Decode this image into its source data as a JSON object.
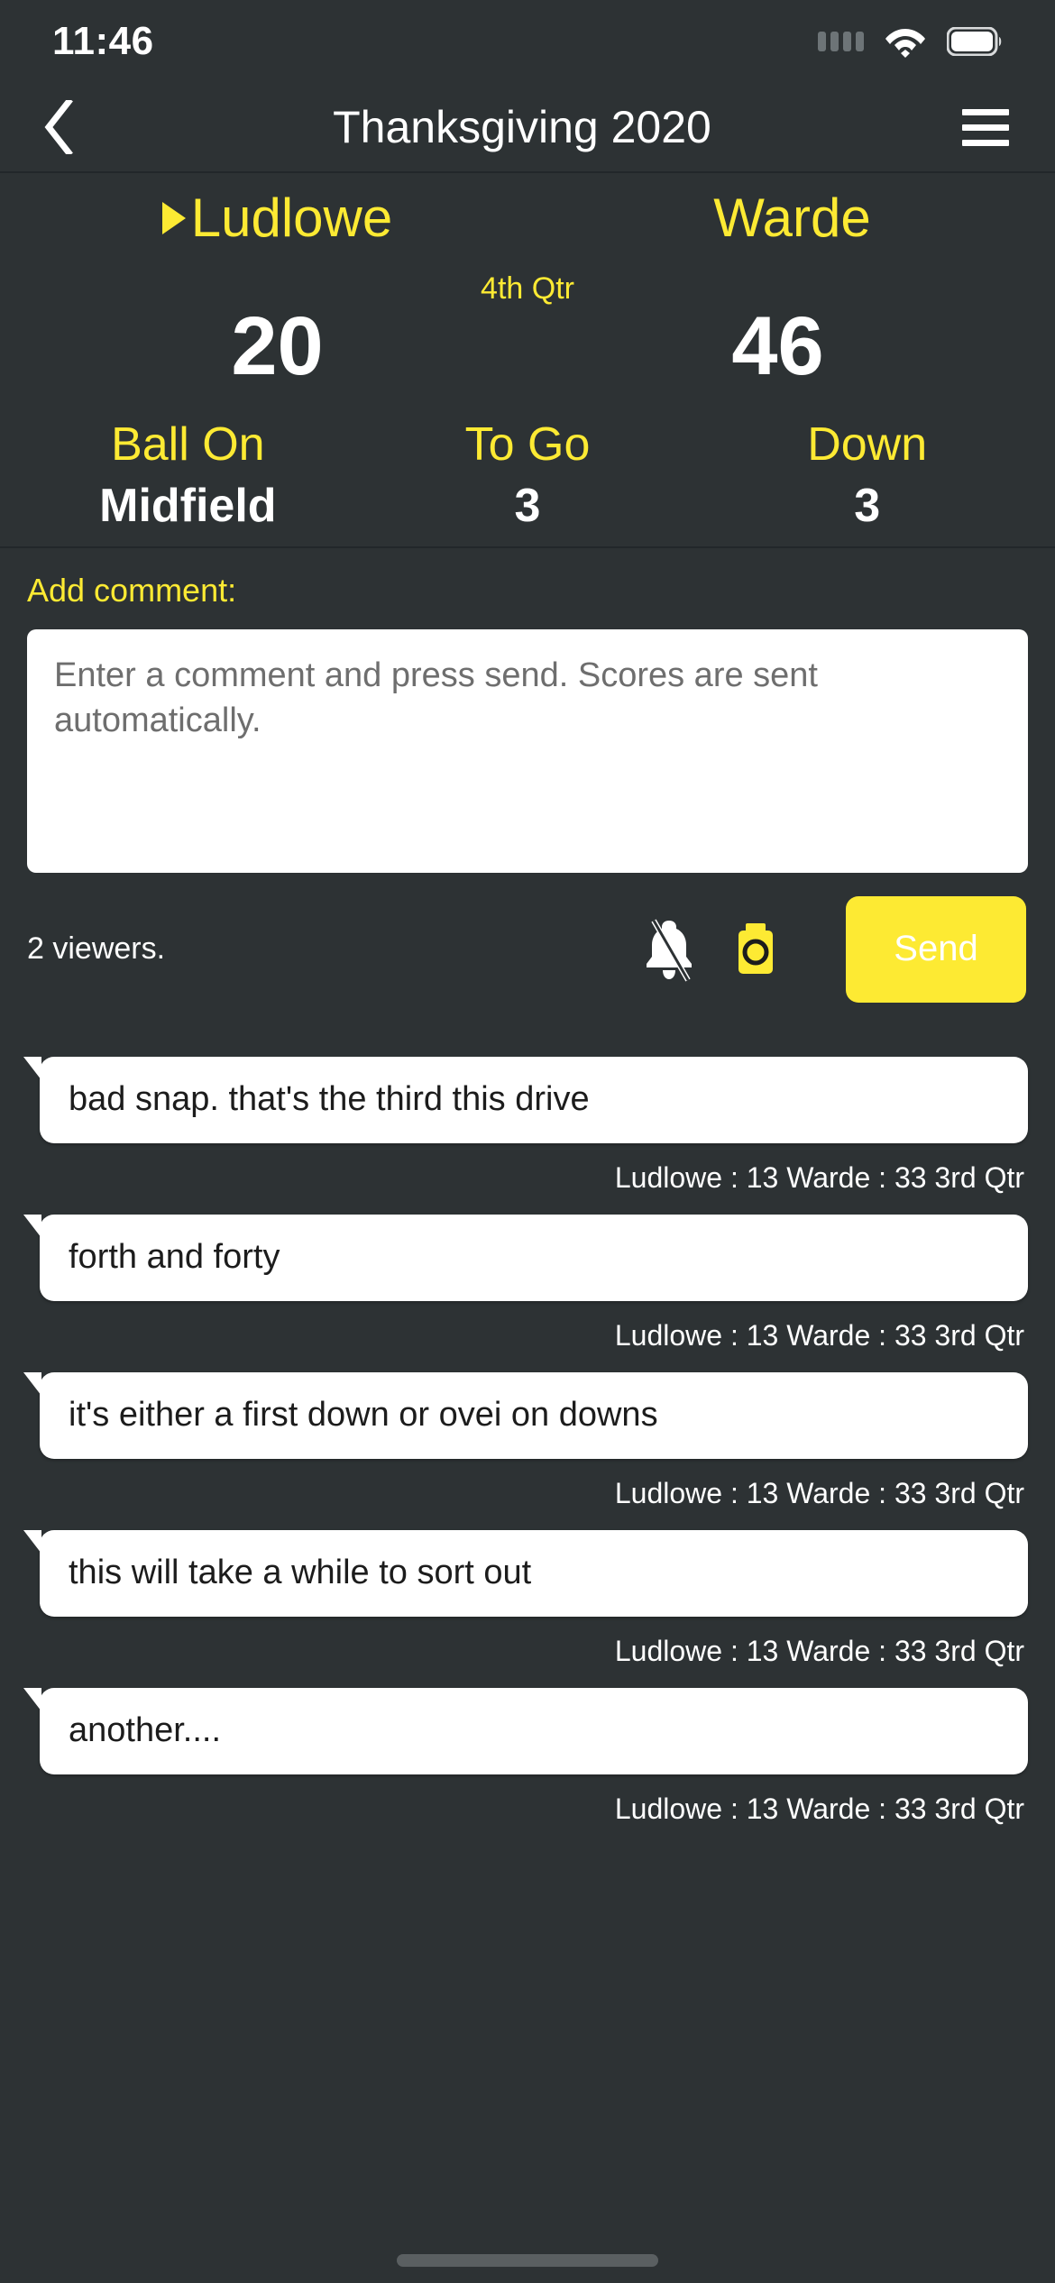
{
  "status_bar": {
    "time": "11:46",
    "signal_icon": "signal-dots-icon",
    "wifi_icon": "wifi-icon",
    "battery_icon": "battery-full-icon"
  },
  "nav": {
    "back_icon": "chevron-left-icon",
    "title": "Thanksgiving 2020",
    "menu_icon": "hamburger-menu-icon"
  },
  "scoreboard": {
    "home_team": "Ludlowe",
    "away_team": "Warde",
    "possession": "home",
    "possession_icon": "possession-arrow-icon",
    "home_score": "20",
    "away_score": "46",
    "period": "4th Qtr",
    "stats": [
      {
        "label": "Ball On",
        "value": "Midfield"
      },
      {
        "label": "To Go",
        "value": "3"
      },
      {
        "label": "Down",
        "value": "3"
      }
    ]
  },
  "composer": {
    "label": "Add comment:",
    "placeholder": "Enter a comment and press send. Scores are sent automatically.",
    "value": "",
    "viewers": "2 viewers.",
    "bell_icon": "bell-off-icon",
    "camera_icon": "camera-icon",
    "send_label": "Send"
  },
  "messages": [
    {
      "text": "bad snap. that's the third this drive",
      "meta": "Ludlowe  : 13 Warde : 33 3rd Qtr"
    },
    {
      "text": "forth and forty",
      "meta": "Ludlowe  : 13 Warde : 33 3rd Qtr"
    },
    {
      "text": "it's either a first down or ovei on downs",
      "meta": "Ludlowe  : 13 Warde : 33 3rd Qtr"
    },
    {
      "text": "this will take a while to sort out",
      "meta": "Ludlowe  : 13 Warde : 33 3rd Qtr"
    },
    {
      "text": "another....",
      "meta": "Ludlowe  : 13 Warde : 33 3rd Qtr"
    }
  ],
  "colors": {
    "background": "#2d3234",
    "accent": "#fdea33",
    "bubble": "#ffffff",
    "text_light": "#ffffff"
  }
}
